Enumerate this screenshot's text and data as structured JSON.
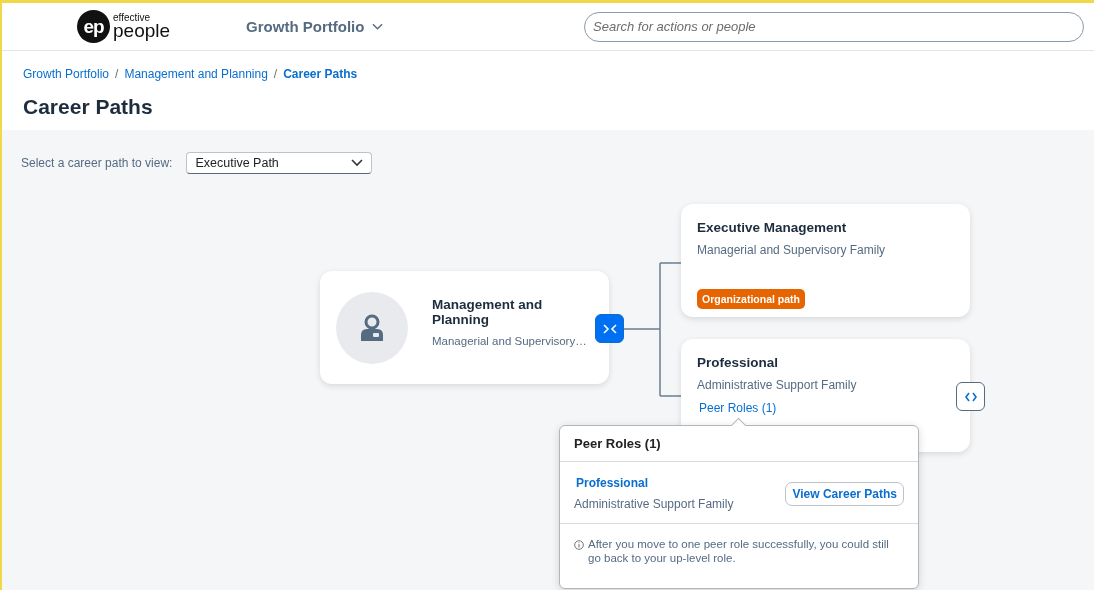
{
  "header": {
    "logo": {
      "mark": "ep",
      "line_1": "effective",
      "line_2": "people"
    },
    "menu": {
      "label": "Growth Portfolio",
      "expanded": false
    },
    "search": {
      "placeholder": "Search for actions or people"
    }
  },
  "breadcrumb_separator": "/",
  "breadcrumb": [
    {
      "label": "Growth Portfolio",
      "current": false
    },
    {
      "label": "Management and Planning",
      "current": false
    },
    {
      "label": "Career Paths",
      "current": true
    }
  ],
  "page_title": "Career Paths",
  "path_select": {
    "label": "Select a career path to view:",
    "value": "Executive Path"
  },
  "current_role": {
    "title": "Management and Planning",
    "family": "Managerial and Supervisory…",
    "expanded": true
  },
  "next_roles": [
    {
      "title": "Executive Management",
      "family": "Managerial and Supervisory Family",
      "badge": "Organizational path"
    },
    {
      "title": "Professional",
      "family": "Administrative Support Family",
      "link": "Peer Roles (1)"
    }
  ],
  "peer_popover": {
    "title": "Peer Roles (1)",
    "roles": [
      {
        "title": "Professional",
        "family": "Administrative Support Family",
        "button": "View Career Paths"
      }
    ],
    "note": "After you move to one peer role successfully, you could still go back to your up-level role."
  }
}
